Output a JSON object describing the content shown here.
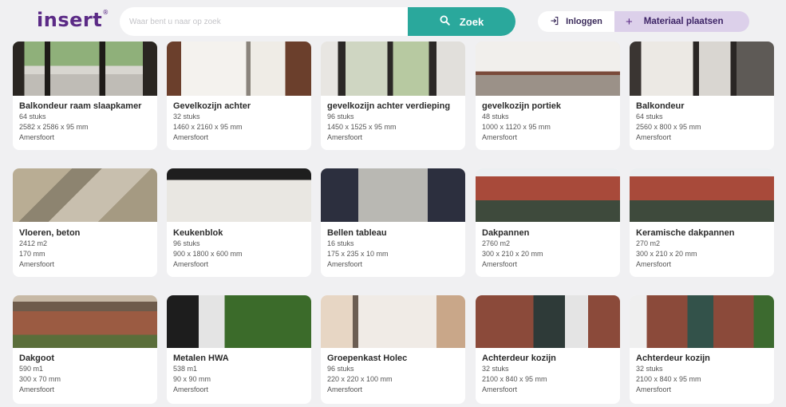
{
  "header": {
    "logo": "insert",
    "logo_mark": "®",
    "search_placeholder": "Waar bent u naar op zoek",
    "search_button": "Zoek",
    "login_button": "Inloggen",
    "place_button": "Materiaal plaatsen"
  },
  "items": [
    {
      "title": "Balkondeur raam slaapkamer",
      "qty": "64 stuks",
      "dims": "2582 x 2586 x 95 mm",
      "city": "Amersfoort"
    },
    {
      "title": "Gevelkozijn achter",
      "qty": "32 stuks",
      "dims": "1460 x 2160 x 95 mm",
      "city": "Amersfoort"
    },
    {
      "title": "gevelkozijn achter verdieping",
      "qty": "96 stuks",
      "dims": "1450 x 1525 x 95 mm",
      "city": "Amersfoort"
    },
    {
      "title": "gevelkozijn portiek",
      "qty": "48 stuks",
      "dims": "1000 x 1120 x 95 mm",
      "city": "Amersfoort"
    },
    {
      "title": "Balkondeur",
      "qty": "64 stuks",
      "dims": "2560 x 800 x 95 mm",
      "city": "Amersfoort"
    },
    {
      "title": "Vloeren, beton",
      "qty": "2412 m2",
      "dims": "170 mm",
      "city": "Amersfoort"
    },
    {
      "title": "Keukenblok",
      "qty": "96 stuks",
      "dims": "900 x 1800 x 600 mm",
      "city": "Amersfoort"
    },
    {
      "title": "Bellen tableau",
      "qty": "16 stuks",
      "dims": "175 x 235 x 10 mm",
      "city": "Amersfoort"
    },
    {
      "title": "Dakpannen",
      "qty": "2760 m2",
      "dims": "300 x 210 x 20 mm",
      "city": "Amersfoort"
    },
    {
      "title": "Keramische dakpannen",
      "qty": "270 m2",
      "dims": "300 x 210 x 20 mm",
      "city": "Amersfoort"
    },
    {
      "title": "Dakgoot",
      "qty": "590 m1",
      "dims": "300 x 70 mm",
      "city": "Amersfoort"
    },
    {
      "title": "Metalen HWA",
      "qty": "538 m1",
      "dims": "90 x 90 mm",
      "city": "Amersfoort"
    },
    {
      "title": "Groepenkast Holec",
      "qty": "96 stuks",
      "dims": "220 x 220 x 100 mm",
      "city": "Amersfoort"
    },
    {
      "title": "Achterdeur kozijn",
      "qty": "32 stuks",
      "dims": "2100 x 840 x 95 mm",
      "city": "Amersfoort"
    },
    {
      "title": "Achterdeur kozijn",
      "qty": "32 stuks",
      "dims": "2100 x 840 x 95 mm",
      "city": "Amersfoort"
    }
  ]
}
